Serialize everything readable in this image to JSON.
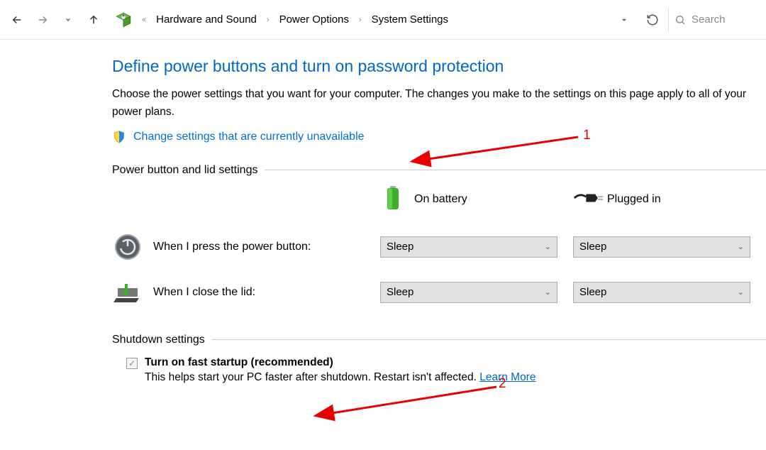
{
  "toolbar": {
    "breadcrumb": [
      "Hardware and Sound",
      "Power Options",
      "System Settings"
    ],
    "search_placeholder": "Search"
  },
  "page": {
    "title": "Define power buttons and turn on password protection",
    "intro": "Choose the power settings that you want for your computer. The changes you make to the settings on this page apply to all of your power plans.",
    "change_link": "Change settings that are currently unavailable"
  },
  "sections": {
    "power_button": {
      "header": "Power button and lid settings",
      "col_battery": "On battery",
      "col_plugged": "Plugged in",
      "rows": [
        {
          "label": "When I press the power button:",
          "battery": "Sleep",
          "plugged": "Sleep"
        },
        {
          "label": "When I close the lid:",
          "battery": "Sleep",
          "plugged": "Sleep"
        }
      ]
    },
    "shutdown": {
      "header": "Shutdown settings",
      "fast_startup": {
        "label": "Turn on fast startup (recommended)",
        "desc_prefix": "This helps start your PC faster after shutdown. Restart isn't affected. ",
        "learn": "Learn More"
      }
    }
  },
  "annotations": {
    "label1": "1",
    "label2": "2"
  }
}
